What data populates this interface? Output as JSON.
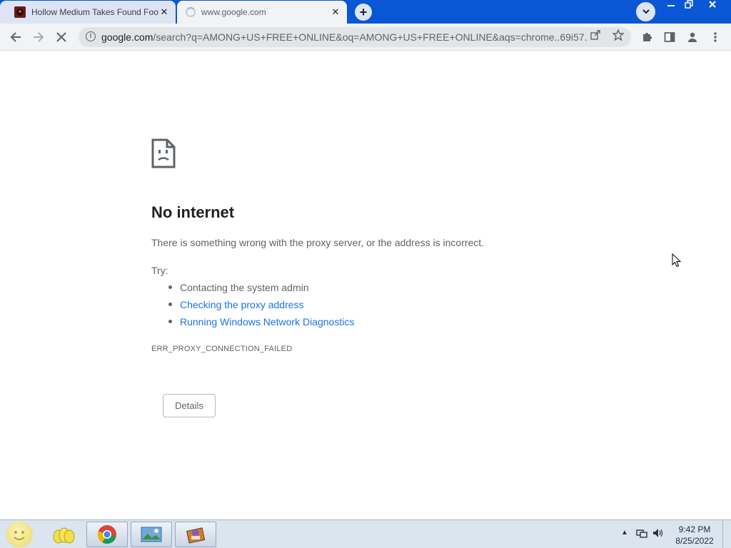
{
  "browser": {
    "tabs": [
      {
        "title": "Hollow Medium Takes Found Footage",
        "close": "✕",
        "favicon": "website-favicon-icon",
        "active": false
      },
      {
        "title": "www.google.com",
        "close": "✕",
        "favicon": "loading-spinner-icon",
        "active": true
      }
    ],
    "new_tab": "+",
    "tab_search": "⌄",
    "window_controls": {
      "minimize": "—",
      "restore": "❐",
      "close": "✕"
    },
    "toolbar": {
      "back_icon": "back-arrow-icon",
      "forward_icon": "forward-arrow-icon",
      "stop_icon": "stop-loading-icon",
      "url_host": "google.com",
      "url_rest": "/search?q=AMONG+US+FREE+ONLINE&oq=AMONG+US+FREE+ONLINE&aqs=chrome..69i57...",
      "extensions_icon": "puzzle-piece-icon",
      "side_panel_icon": "side-panel-icon",
      "profile_icon": "profile-icon",
      "menu_icon": "kebab-menu-icon"
    }
  },
  "error_page": {
    "title": "No internet",
    "description": "There is something wrong with the proxy server, or the address is incorrect.",
    "try_label": "Try:",
    "suggestions": [
      {
        "text": "Contacting the system admin",
        "link": false
      },
      {
        "text": "Checking the proxy address",
        "link": true
      },
      {
        "text": "Running Windows Network Diagnostics",
        "link": true
      }
    ],
    "error_code": "ERR_PROXY_CONNECTION_FAILED",
    "details_button": "Details"
  },
  "taskbar": {
    "apps": [
      "start-orb-icon",
      "windows-explorer-icon",
      "chrome-icon",
      "photo-viewer-icon",
      "media-app-icon"
    ],
    "clock_time": "9:42 PM",
    "clock_date": "8/25/2022"
  },
  "colors": {
    "title_bar": "#0a57d6",
    "toolbar": "#f1f3f4",
    "link": "#1a73e8",
    "heading": "#202124",
    "body_text": "#5f6368",
    "taskbar": "#dbe5ef"
  }
}
